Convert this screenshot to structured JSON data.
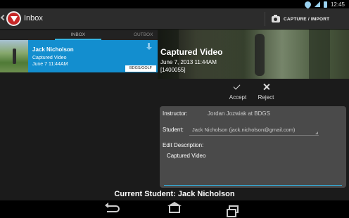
{
  "status_bar": {
    "time": "12:45",
    "icons": [
      "wifi-icon",
      "signal-icon",
      "battery-icon"
    ]
  },
  "action_bar": {
    "title": "Inbox",
    "capture_label": "CAPTURE / IMPORT"
  },
  "tabs": [
    {
      "label": "INBOX",
      "active": true
    },
    {
      "label": "OUTBOX",
      "active": false
    }
  ],
  "inbox_items": [
    {
      "name": "Jack Nicholson",
      "type": "Captured Video",
      "date": "June 7 11:44AM",
      "badge": "BDGS/GOLF"
    }
  ],
  "video": {
    "title": "Captured Video",
    "date": "June 7, 2013 11:44AM",
    "id": "[1400055]"
  },
  "actions": {
    "accept_label": "Accept",
    "reject_label": "Reject"
  },
  "details": {
    "instructor_label": "Instructor:",
    "instructor_value": "Jordan Jozwiak at BDGS",
    "student_label": "Student:",
    "student_value": "Jack Nicholson (jack.nicholson@gmail.com)",
    "description_label": "Edit Description:",
    "description_value": "Captured Video"
  },
  "footer": {
    "current_student": "Current Student: Jack Nicholson"
  },
  "colors": {
    "accent": "#33b5e5",
    "selected_item": "#138ecf",
    "panel": "#4a4a4a",
    "background": "#1b1b1b"
  }
}
